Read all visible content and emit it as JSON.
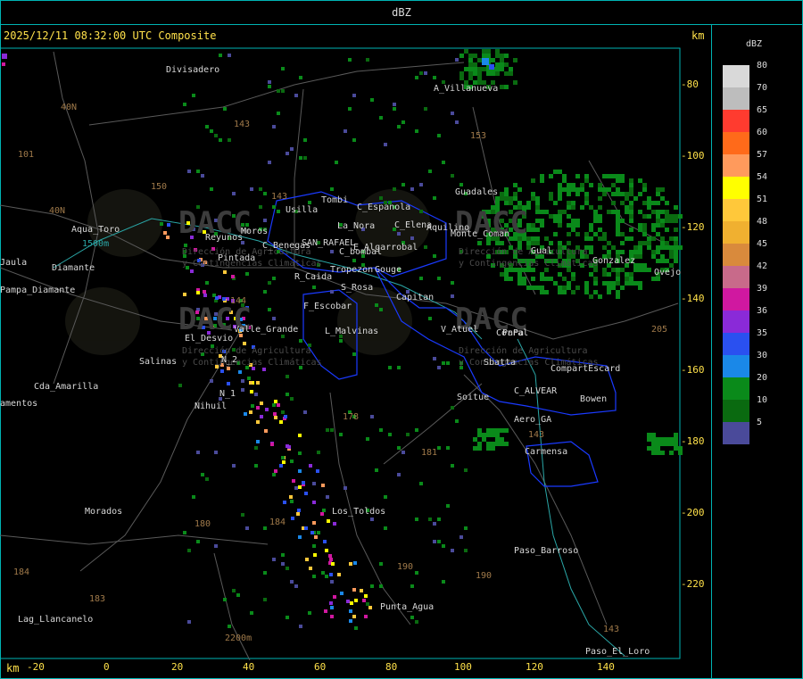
{
  "window": {
    "title": "dBZ"
  },
  "header": {
    "timestamp": "2025/12/11 08:32:00 UTC Composite",
    "unit_top": "km",
    "unit_bottom": "km"
  },
  "axes": {
    "x_ticks": [
      "-20",
      "0",
      "20",
      "40",
      "60",
      "80",
      "100",
      "120",
      "140"
    ],
    "y_ticks": [
      "-80",
      "-100",
      "-120",
      "-140",
      "-160",
      "-180",
      "-200",
      "-220"
    ]
  },
  "legend": {
    "title": "dBZ",
    "levels": [
      {
        "value": "80",
        "color": "#d9d9d9"
      },
      {
        "value": "70",
        "color": "#bdbdbd"
      },
      {
        "value": "65",
        "color": "#ff3b2f"
      },
      {
        "value": "60",
        "color": "#ff6a1a"
      },
      {
        "value": "57",
        "color": "#ff9a5c"
      },
      {
        "value": "54",
        "color": "#ffff00"
      },
      {
        "value": "51",
        "color": "#ffc83a"
      },
      {
        "value": "48",
        "color": "#f0b030"
      },
      {
        "value": "45",
        "color": "#d98a3c"
      },
      {
        "value": "42",
        "color": "#c86a8a"
      },
      {
        "value": "39",
        "color": "#d018a0"
      },
      {
        "value": "36",
        "color": "#8a2ad8"
      },
      {
        "value": "35",
        "color": "#2a50f0"
      },
      {
        "value": "30",
        "color": "#1a88e8"
      },
      {
        "value": "20",
        "color": "#0a8a1a"
      },
      {
        "value": "10",
        "color": "#0a6a10"
      },
      {
        "value": "5",
        "color": "#4a4a9a"
      }
    ]
  },
  "places": [
    "Divisadero",
    "A_Villanueva",
    "Tombi",
    "Usilla",
    "C_Espanola",
    "La_Nora",
    "C_Elena",
    "Guadales",
    "Aquilino",
    "Aqua_Toro",
    "SAN_RAFAEL",
    "C_Benegas",
    "E_Algarrobal",
    "Reyunos",
    "C_bombal",
    "Pintada",
    "Tropezon",
    "Gouge",
    "R_Caida",
    "S_Rosa",
    "Pampa_Diamante",
    "Salinas",
    "El_Desvio",
    "Valle_Grande",
    "L_Malvinas",
    "V_Atuel",
    "Cda_Amarilla",
    "Nihuil",
    "Soitue",
    "CompartEscard",
    "Bowen",
    "C_ALVEAR",
    "Aero_GA",
    "Carmensa",
    "Los_Toldos",
    "Morados",
    "Paso_Barroso",
    "Punta_Agua",
    "Lag_Llancanelo",
    "Paso_El_Loro",
    "Ovejo",
    "Jaula",
    "N_1",
    "N_2",
    "Gual",
    "Sbatta",
    "Gonzalez",
    "Capitan",
    "Monte_Coman",
    "Moros",
    "F_Escobar",
    "Corral",
    "Diamante",
    "amentos",
    "PaPa"
  ],
  "routes": [
    "101",
    "143",
    "153",
    "40N",
    "40N",
    "144",
    "143",
    "190",
    "180",
    "184",
    "184",
    "183",
    "143",
    "143",
    "150",
    "178",
    "181",
    "205",
    "190"
  ],
  "elevations": [
    "1500m",
    "2200m"
  ],
  "watermark": {
    "brand": "DACC",
    "line1": "Dirección de Agricultura",
    "line2": "y Contingencias Climáticas"
  },
  "colors": {
    "frame": "#00b3b3",
    "header_text": "#ffe14a",
    "boundary": "#1a3aff",
    "river": "#2aa7a7"
  }
}
